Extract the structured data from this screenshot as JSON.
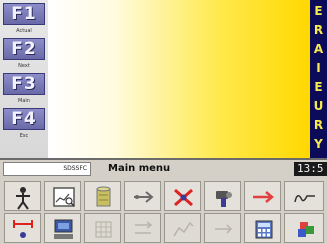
{
  "fkeys": [
    {
      "key": "F1",
      "label": "Actual"
    },
    {
      "key": "F2",
      "label": "Next"
    },
    {
      "key": "F3",
      "label": "Main"
    },
    {
      "key": "F4",
      "label": "Esc"
    }
  ],
  "side_letters": [
    "E",
    "R",
    "A",
    "I",
    "E",
    "U",
    "R",
    "Y"
  ],
  "titlebar": {
    "field_value": "SDSSFC",
    "title": "Main menu",
    "clock": "13:5"
  },
  "toolbar": {
    "row1": [
      {
        "icon": "stick-figure-icon"
      },
      {
        "icon": "chart-window-icon"
      },
      {
        "icon": "cylinder-icon"
      },
      {
        "icon": "arrow-right-icon"
      },
      {
        "icon": "red-cross-icon"
      },
      {
        "icon": "tools-icon"
      },
      {
        "icon": "red-arrow-icon"
      },
      {
        "icon": "text-cursor-icon"
      }
    ],
    "row2": [
      {
        "icon": "range-icon"
      },
      {
        "icon": "computer-icon"
      },
      {
        "icon": "grid-dim-icon"
      },
      {
        "icon": "dim-arrows-icon"
      },
      {
        "icon": "dim-chart-icon"
      },
      {
        "icon": "dim-arrow-icon"
      },
      {
        "icon": "calculator-icon"
      },
      {
        "icon": "colors-icon"
      }
    ]
  },
  "colors": {
    "fkey": "#6a6aa8",
    "display_start": "#ffffff",
    "display_end": "#ffd800",
    "letter_bg": "#0b0b5a",
    "letter_fg": "#f7e94e"
  }
}
